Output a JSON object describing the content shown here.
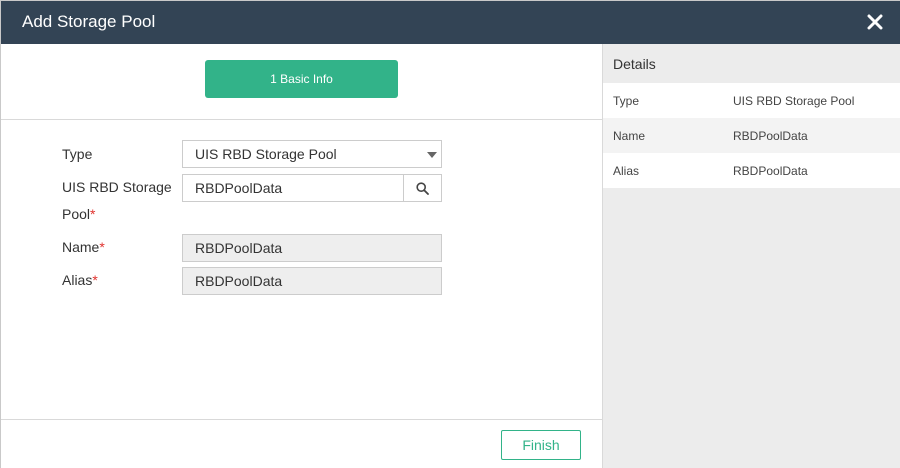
{
  "dialog": {
    "title": "Add Storage Pool"
  },
  "steps": {
    "current_label": "1 Basic Info"
  },
  "form": {
    "type_label": "Type",
    "type_value": "UIS RBD Storage Pool",
    "pool_label_line1": "UIS RBD Storage",
    "pool_label_line2": "Pool",
    "pool_value": "RBDPoolData",
    "name_label": "Name",
    "name_value": "RBDPoolData",
    "alias_label": "Alias",
    "alias_value": "RBDPoolData",
    "required_mark": "*"
  },
  "footer": {
    "finish_label": "Finish"
  },
  "details": {
    "title": "Details",
    "rows": [
      {
        "key": "Type",
        "value": "UIS RBD Storage Pool"
      },
      {
        "key": "Name",
        "value": "RBDPoolData"
      },
      {
        "key": "Alias",
        "value": "RBDPoolData"
      }
    ]
  },
  "colors": {
    "titlebar": "#334455",
    "accent": "#32b389",
    "required": "#e0322e"
  }
}
